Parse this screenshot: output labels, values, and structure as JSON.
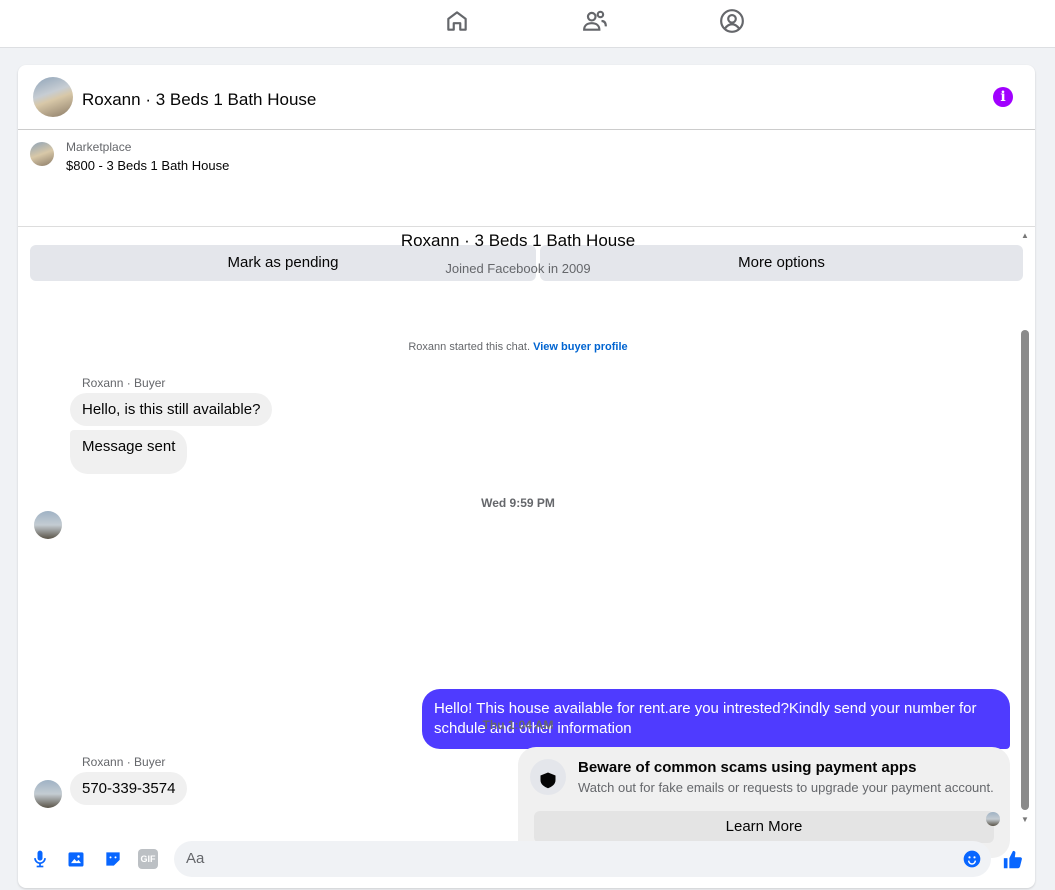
{
  "nav": {
    "icons": [
      "home-icon",
      "friends-icon",
      "profile-icon"
    ]
  },
  "header": {
    "title": "Roxann · 3 Beds 1 Bath House",
    "info_icon": "info-icon",
    "accent": "#a100ff"
  },
  "listing": {
    "source": "Marketplace",
    "item": "$800 - 3 Beds 1 Bath House",
    "mark_pending": "Mark as pending",
    "more_options": "More options"
  },
  "chat": {
    "name": "Roxann · 3 Beds 1 Bath House",
    "joined": "Joined Facebook in 2009",
    "started": "Roxann started this chat.",
    "view_profile": "View buyer profile",
    "messages": [
      {
        "sender": "Roxann · Buyer",
        "text": "Hello, is this still available?"
      },
      {
        "text": "Message sent"
      },
      {
        "timestamp": "Wed 9:59 PM"
      },
      {
        "text": "Hello! This house available for rent.are you intrested?Kindly send your number for schdule and other information",
        "outgoing": true,
        "color": "#4f3bff"
      },
      {
        "timestamp": "Thu 1:04 AM"
      },
      {
        "sender": "Roxann · Buyer",
        "text": "570-339-3574"
      }
    ],
    "scam": {
      "title": "Beware of common scams using payment apps",
      "body": "Watch out for fake emails or requests to upgrade your payment account.",
      "button": "Learn More"
    }
  },
  "composer": {
    "placeholder": "Aa",
    "icons": [
      "microphone-icon",
      "photo-icon",
      "sticker-icon",
      "gif-icon",
      "emoji-icon",
      "like-icon"
    ],
    "accent": "#0866ff"
  }
}
